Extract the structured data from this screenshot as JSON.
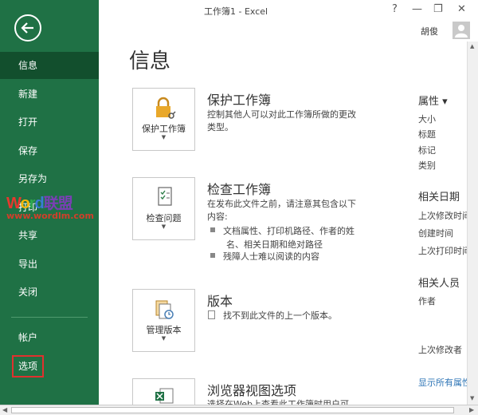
{
  "window": {
    "title": "工作簿1 - Excel",
    "help": "?",
    "minimize": "—",
    "restore": "❐",
    "close": "✕",
    "user": "胡俊"
  },
  "sidebar": {
    "items": [
      {
        "label": "信息"
      },
      {
        "label": "新建"
      },
      {
        "label": "打开"
      },
      {
        "label": "保存"
      },
      {
        "label": "另存为"
      },
      {
        "label": "打印"
      },
      {
        "label": "共享"
      },
      {
        "label": "导出"
      },
      {
        "label": "关闭"
      },
      {
        "label": "帐户"
      },
      {
        "label": "选项"
      }
    ]
  },
  "watermark": {
    "w": "W",
    "o": "o",
    "r": "r",
    "d": "d",
    "cn": "联盟",
    "url": "www.wordlm.com"
  },
  "main": {
    "title": "信息",
    "protect": {
      "button": "保护工作簿",
      "title": "保护工作簿",
      "desc": "控制其他人可以对此工作簿所做的更改类型。"
    },
    "inspect": {
      "button": "检查问题",
      "title": "检查工作簿",
      "desc": "在发布此文件之前，请注意其包含以下内容:",
      "bullets": [
        "文档属性、打印机路径、作者的姓",
        "残障人士难以阅读的内容"
      ],
      "bullet_cont": "名、相关日期和绝对路径"
    },
    "versions": {
      "button": "管理版本",
      "title": "版本",
      "desc": "找不到此文件的上一个版本。"
    },
    "browser": {
      "title": "浏览器视图选项",
      "desc": "选择在Web上查看此工作簿时用户可"
    }
  },
  "props": {
    "head": "属性 ▾",
    "items": [
      "大小",
      "标题",
      "标记",
      "类别"
    ],
    "dates_head": "相关日期",
    "dates": [
      "上次修改时间",
      "创建时间",
      "上次打印时间"
    ],
    "people_head": "相关人员",
    "people": [
      "作者"
    ],
    "modified_by": "上次修改者",
    "show_all": "显示所有属性"
  }
}
